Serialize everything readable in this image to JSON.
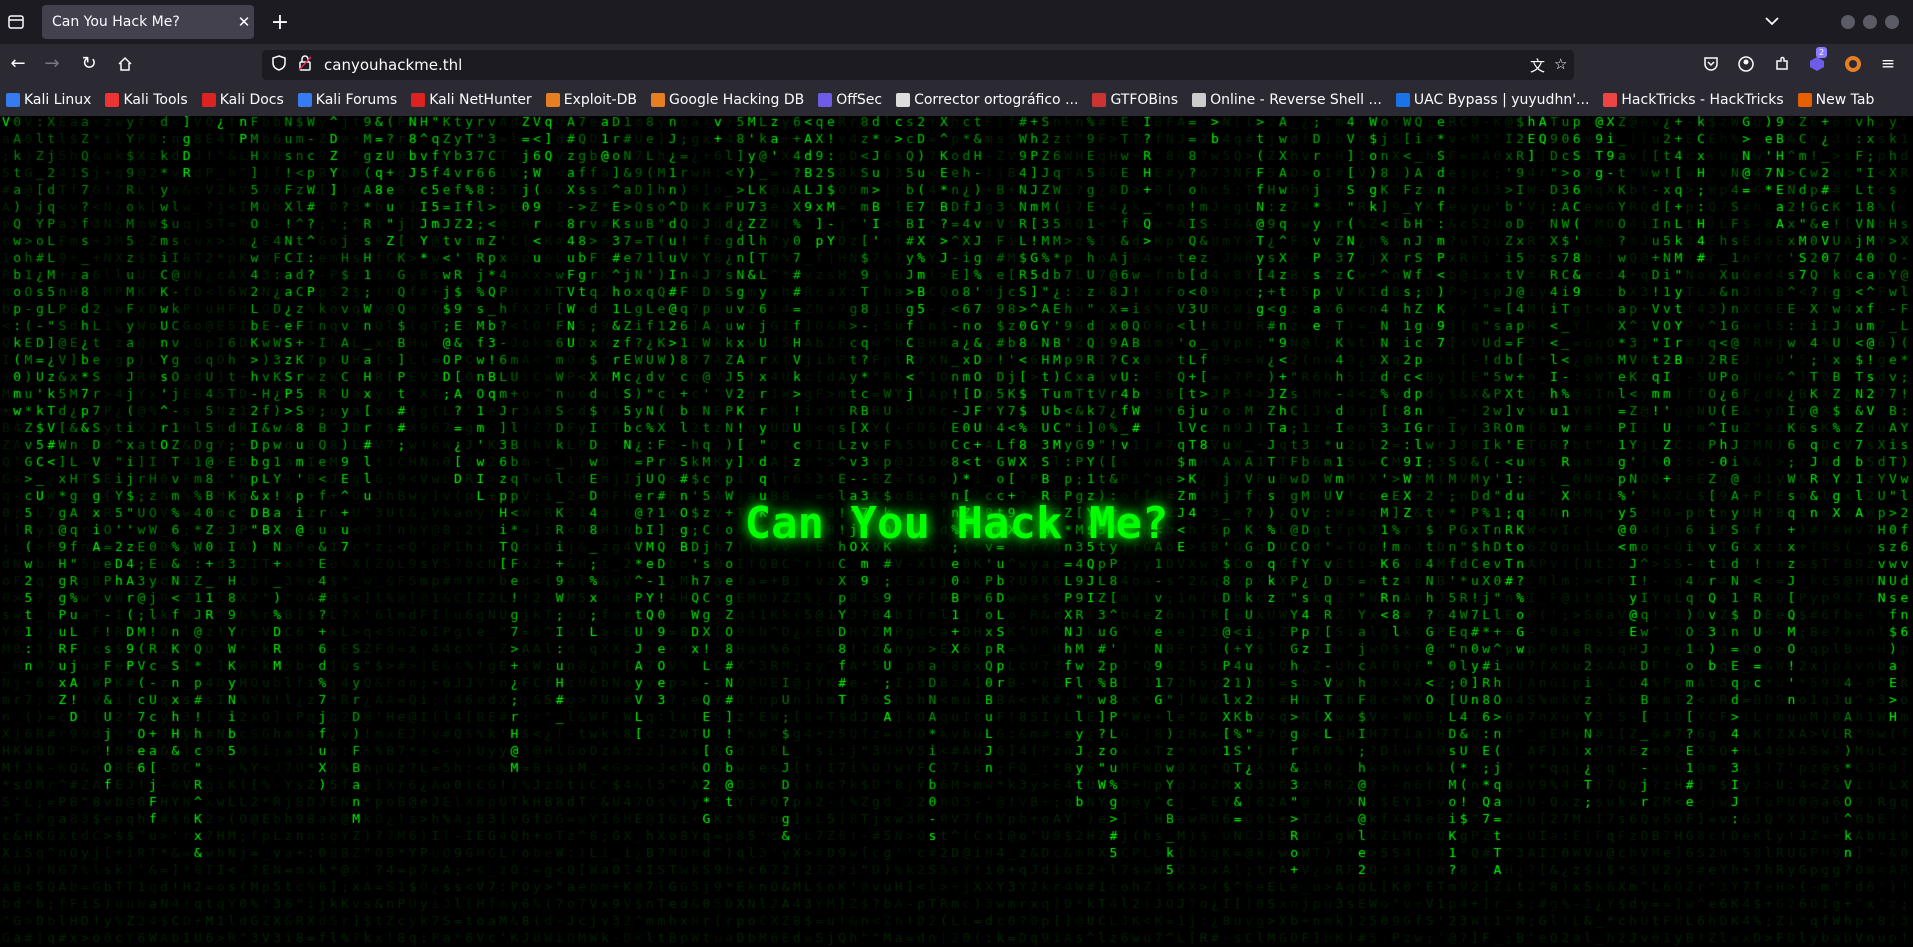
{
  "tabs": [
    {
      "title": "Can You Hack Me?",
      "close": "✕"
    }
  ],
  "new_tab": "+",
  "url": "canyouhackme.thl",
  "bookmarks": [
    {
      "label": "Kali Linux",
      "color": "#367bf0"
    },
    {
      "label": "Kali Tools",
      "color": "#e33"
    },
    {
      "label": "Kali Docs",
      "color": "#d22"
    },
    {
      "label": "Kali Forums",
      "color": "#367bf0"
    },
    {
      "label": "Kali NetHunter",
      "color": "#d22"
    },
    {
      "label": "Exploit-DB",
      "color": "#e67e22"
    },
    {
      "label": "Google Hacking DB",
      "color": "#e67e22"
    },
    {
      "label": "OffSec",
      "color": "#6d5ce8"
    },
    {
      "label": "Corrector ortográfico ...",
      "color": "#ddd"
    },
    {
      "label": "GTFOBins",
      "color": "#c33"
    },
    {
      "label": "Online - Reverse Shell ...",
      "color": "#ccc"
    },
    {
      "label": "UAC Bypass | yuyudhn'...",
      "color": "#1a73e8"
    },
    {
      "label": "HackTricks - HackTricks",
      "color": "#e44"
    },
    {
      "label": "New Tab",
      "color": "#e66000"
    }
  ],
  "extension_badge": "2",
  "headline": "Can You Hack Me?",
  "colors": {
    "rain": "#00ff00",
    "headline": "#00ff00",
    "background": "#000000"
  }
}
